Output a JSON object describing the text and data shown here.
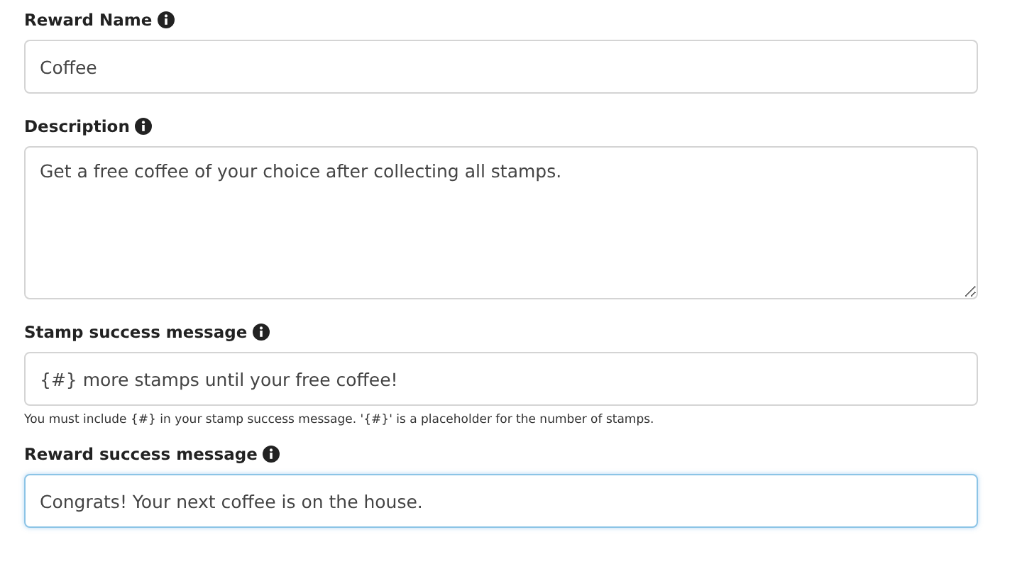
{
  "fields": [
    {
      "label": "Reward Name",
      "kind": "input",
      "value": "Coffee",
      "focused": false
    },
    {
      "label": "Description",
      "kind": "textarea",
      "value": "Get a free coffee of your choice after collecting all stamps.",
      "focused": false
    },
    {
      "label": "Stamp success message",
      "kind": "input",
      "value": "{#} more stamps until your free coffee!",
      "focused": false,
      "help": "You must include {#} in your stamp success message. '{#}' is a placeholder for the number of stamps."
    },
    {
      "label": "Reward success message",
      "kind": "input",
      "value": "Congrats! Your next coffee is on the house.",
      "focused": true
    }
  ]
}
